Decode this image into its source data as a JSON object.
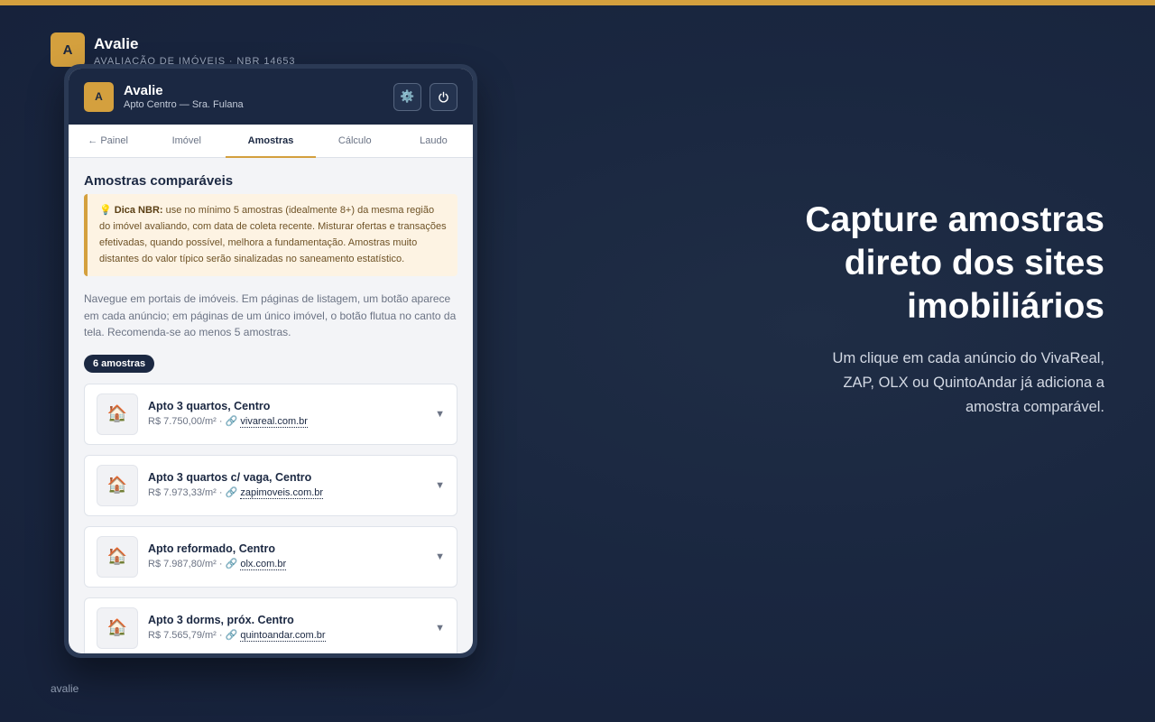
{
  "brand": {
    "logo_letter": "A",
    "name": "Avalie",
    "subtitle": "AVALIAÇÃO DE IMÓVEIS · NBR 14653"
  },
  "footer": "avalie",
  "hero": {
    "title_lines": [
      "Capture amostras",
      "direto dos sites",
      "imobiliários"
    ],
    "description_lines": [
      "Um clique em cada anúncio do VivaReal,",
      "ZAP, OLX ou QuintoAndar já adiciona a",
      "amostra comparável."
    ]
  },
  "app": {
    "logo_letter": "A",
    "name": "Avalie",
    "subtitle": "Apto Centro — Sra. Fulana",
    "settings_icon": "gear-icon",
    "power_icon": "power-icon"
  },
  "tabs": [
    {
      "label": "← Painel",
      "active": false
    },
    {
      "label": "Imóvel",
      "active": false
    },
    {
      "label": "Amostras",
      "active": true
    },
    {
      "label": "Cálculo",
      "active": false
    },
    {
      "label": "Laudo",
      "active": false
    }
  ],
  "section": {
    "title": "Amostras comparáveis",
    "tip_icon": "💡",
    "tip_label": "Dica NBR:",
    "tip_text": " use no mínimo 5 amostras (idealmente 8+) da mesma região do imóvel avaliando, com data de coleta recente. Misturar ofertas e transações efetivadas, quando possível, melhora a fundamentação. Amostras muito distantes do valor típico serão sinalizadas no saneamento estatístico.",
    "description": "Navegue em portais de imóveis. Em páginas de listagem, um botão aparece em cada anúncio; em páginas de um único imóvel, o botão flutua no canto da tela. Recomenda-se ao menos 5 amostras.",
    "count_badge": "6 amostras"
  },
  "samples": [
    {
      "title": "Apto 3 quartos, Centro",
      "price": "R$ 7.750,00/m²",
      "source": "vivareal.com.br"
    },
    {
      "title": "Apto 3 quartos c/ vaga, Centro",
      "price": "R$ 7.973,33/m²",
      "source": "zapimoveis.com.br"
    },
    {
      "title": "Apto reformado, Centro",
      "price": "R$ 7.987,80/m²",
      "source": "olx.com.br"
    },
    {
      "title": "Apto 3 dorms, próx. Centro",
      "price": "R$ 7.565,79/m²",
      "source": "quintoandar.com.br"
    }
  ],
  "sample_icon": "🏠",
  "link_icon": "🔗",
  "chevron": "▼"
}
